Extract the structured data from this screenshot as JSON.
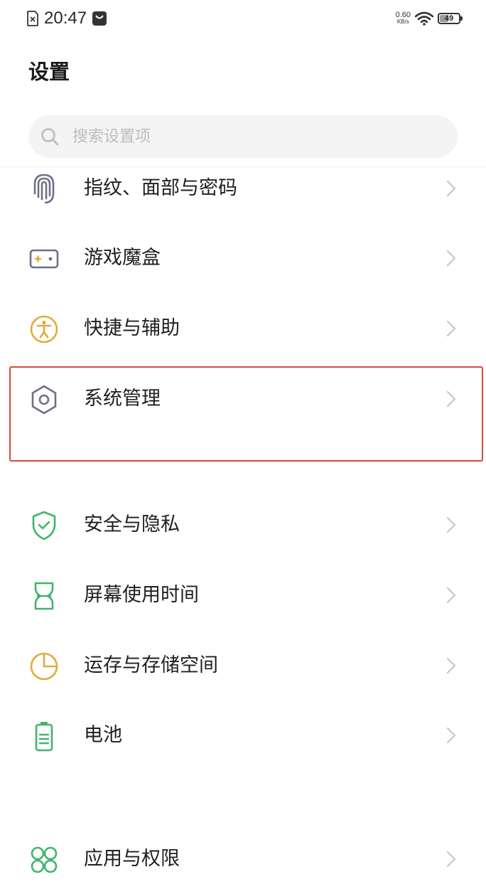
{
  "status_bar": {
    "time": "20:47",
    "net_speed_value": "0.60",
    "net_speed_unit": "KB/s",
    "battery_level": 49
  },
  "header": {
    "title": "设置"
  },
  "search": {
    "placeholder": "搜索设置项",
    "value": ""
  },
  "menu": {
    "items": [
      {
        "label": "指纹、面部与密码",
        "icon": "fingerprint-icon",
        "color": "#6f6f8a"
      },
      {
        "label": "游戏魔盒",
        "icon": "gamepad-icon",
        "color": "#6f6f8a"
      },
      {
        "label": "快捷与辅助",
        "icon": "accessibility-icon",
        "color": "#e3a93a"
      },
      {
        "label": "系统管理",
        "icon": "hexagon-settings-icon",
        "color": "#6f6f8a"
      },
      {
        "label": "安全与隐私",
        "icon": "shield-check-icon",
        "color": "#3fb56a"
      },
      {
        "label": "屏幕使用时间",
        "icon": "hourglass-icon",
        "color": "#3fb56a"
      },
      {
        "label": "运存与存储空间",
        "icon": "pie-chart-icon",
        "color": "#e3a93a"
      },
      {
        "label": "电池",
        "icon": "battery-icon",
        "color": "#3fb56a"
      },
      {
        "label": "应用与权限",
        "icon": "apps-grid-icon",
        "color": "#3fb56a"
      }
    ]
  },
  "colors": {
    "highlight_border": "#d64a3e",
    "chevron": "#c7c7c7"
  }
}
